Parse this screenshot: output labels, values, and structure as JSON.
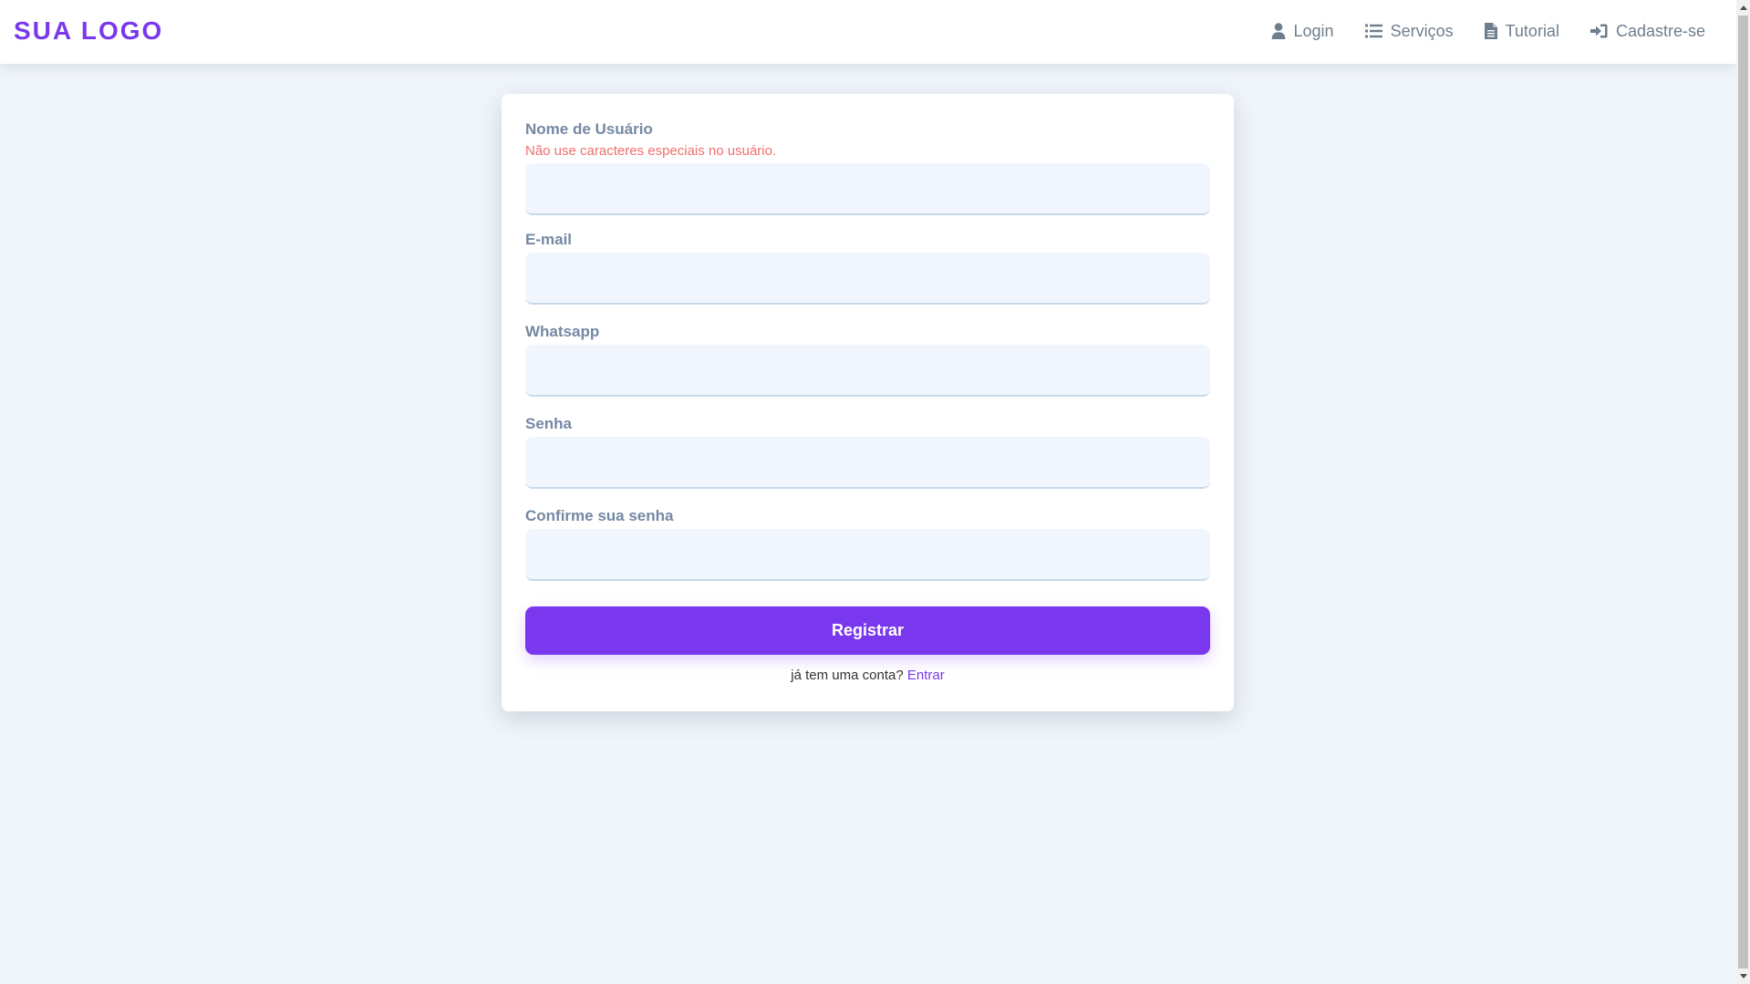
{
  "navbar": {
    "brand": "SUA LOGO",
    "items": [
      {
        "label": "Login",
        "icon": "user-icon"
      },
      {
        "label": "Serviços",
        "icon": "list-icon"
      },
      {
        "label": "Tutorial",
        "icon": "document-icon"
      },
      {
        "label": "Cadastre-se",
        "icon": "sign-in-icon"
      }
    ]
  },
  "form": {
    "username": {
      "label": "Nome de Usuário",
      "hint": "Não use caracteres especiais no usuário.",
      "value": ""
    },
    "email": {
      "label": "E-mail",
      "value": ""
    },
    "whatsapp": {
      "label": "Whatsapp",
      "value": ""
    },
    "password": {
      "label": "Senha",
      "value": ""
    },
    "confirm_password": {
      "label": "Confirme sua senha",
      "value": ""
    },
    "submit_label": "Registrar",
    "login_prompt": "já tem uma conta?",
    "login_link": "Entrar"
  },
  "colors": {
    "brand": "#7a38ee",
    "label": "#7488a3",
    "hint": "#ef6f6c",
    "input_bg": "#f1f6fe",
    "page_bg": "#f0f5fa",
    "nav_text": "#6f7e8d"
  }
}
